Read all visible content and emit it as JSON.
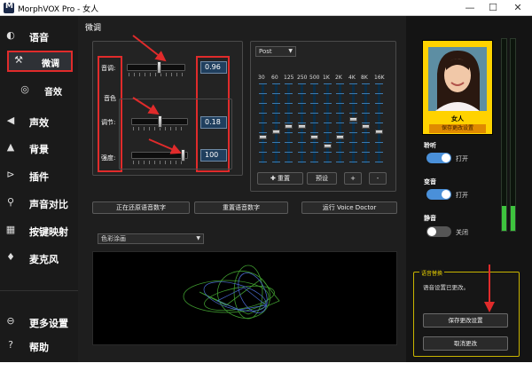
{
  "window": {
    "title": "MorphVOX Pro - 女人",
    "minimize": "—",
    "maximize": "☐",
    "close": "✕"
  },
  "sidebar": {
    "items": [
      {
        "label": "语音",
        "icon": "voice-icon"
      },
      {
        "label": "微调",
        "icon": "tools-icon"
      },
      {
        "label": "音效",
        "icon": "lips-icon"
      },
      {
        "label": "声效",
        "icon": "speaker-icon"
      },
      {
        "label": "背景",
        "icon": "landscape-icon"
      },
      {
        "label": "插件",
        "icon": "plug-icon"
      },
      {
        "label": "声音对比",
        "icon": "search-icon"
      },
      {
        "label": "按键映射",
        "icon": "keyboard-icon"
      },
      {
        "label": "麦克风",
        "icon": "microphone-icon"
      },
      {
        "label": "更多设置",
        "icon": "more-icon"
      },
      {
        "label": "帮助",
        "icon": "help-icon"
      }
    ]
  },
  "tune": {
    "section_title": "微调",
    "pitch_label": "音调:",
    "timbre_label": "音色",
    "adjust_label": "调节:",
    "strength_label": "强度:",
    "pitch_value": "0.96",
    "adjust_value": "0.18",
    "strength_value": "100",
    "pitch_level": 0.55,
    "adjust_level": 0.5,
    "strength_level": 0.95
  },
  "eq": {
    "mode": "Post",
    "bands": [
      "30",
      "60",
      "125",
      "250",
      "500",
      "1K",
      "2K",
      "4K",
      "8K",
      "16K"
    ],
    "levels": [
      0.27,
      0.35,
      0.43,
      0.43,
      0.27,
      0.15,
      0.27,
      0.52,
      0.43,
      0.35
    ],
    "reset_label": "重置",
    "preset_label": "预设",
    "add_label": "+",
    "remove_label": "-"
  },
  "actions": {
    "restoring": "正在还原语音数字",
    "reset_voice": "重置语音数字",
    "voice_doctor": "运行 Voice Doctor"
  },
  "visualizer": {
    "mode": "色彩涂画"
  },
  "voice": {
    "name": "女人",
    "save_label": "保存更改设置"
  },
  "options": {
    "listen_label": "聆听",
    "listen_state": "打开",
    "morph_label": "变音",
    "morph_state": "打开",
    "mute_label": "静音",
    "mute_state": "关闭"
  },
  "meter_levels": [
    0.13,
    0.13
  ],
  "changes": {
    "title": "语音替换",
    "message": "语音设置已更改。",
    "save_button": "保存更改设置",
    "cancel_button": "取消更改"
  },
  "colors": {
    "accent_red": "#e02b2b",
    "toggle_on": "#4a90d9",
    "toggle_off": "#555555",
    "avatar_frame": "#ffd200",
    "change_border": "#c8b400"
  }
}
